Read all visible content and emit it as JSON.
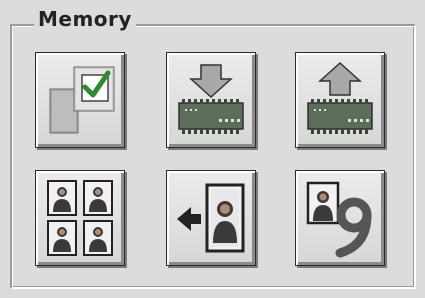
{
  "group": {
    "title": "Memory"
  },
  "buttons": [
    {
      "id": "save-settings",
      "icon": "checkmark-copy-icon"
    },
    {
      "id": "memory-download",
      "icon": "memory-chip-arrow-down-icon"
    },
    {
      "id": "memory-upload",
      "icon": "memory-chip-arrow-up-icon"
    },
    {
      "id": "multi-preview",
      "icon": "four-portraits-grid-icon"
    },
    {
      "id": "import-portrait",
      "icon": "arrow-left-portrait-icon"
    },
    {
      "id": "portrait-nine",
      "icon": "portrait-number-nine-icon"
    }
  ],
  "colors": {
    "panel_bg": "#dcdcdc",
    "chip_green": "#5c6e5a",
    "arrow_fill": "#9a9a9a",
    "check_green": "#2e8b2e",
    "portrait_frame": "#222222"
  }
}
